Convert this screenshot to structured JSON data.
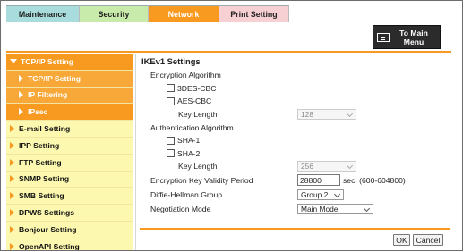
{
  "tabs": {
    "maintenance": "Maintenance",
    "security": "Security",
    "network": "Network",
    "print_setting": "Print Setting"
  },
  "main_menu": {
    "label_line1": "To Main",
    "label_line2": "Menu",
    "icon": "menu-icon"
  },
  "sidebar": {
    "items": [
      {
        "label": "TCP/IP Setting",
        "state": "expanded"
      },
      {
        "label": "TCP/IP Setting",
        "state": "sub"
      },
      {
        "label": "IP Filtering",
        "state": "sub"
      },
      {
        "label": "IPsec",
        "state": "sub-selected"
      },
      {
        "label": "E-mail Setting"
      },
      {
        "label": "IPP Setting"
      },
      {
        "label": "FTP Setting"
      },
      {
        "label": "SNMP Setting"
      },
      {
        "label": "SMB Setting"
      },
      {
        "label": "DPWS Settings"
      },
      {
        "label": "Bonjour Setting"
      },
      {
        "label": "OpenAPI Setting"
      }
    ]
  },
  "content": {
    "title": "IKEv1 Settings",
    "encryption_label": "Encryption Algorithm",
    "enc_3des": "3DES-CBC",
    "enc_aes": "AES-CBC",
    "key_length_label": "Key Length",
    "aes_key_length": "128",
    "auth_label": "Authentication Algorithm",
    "auth_sha1": "SHA-1",
    "auth_sha2": "SHA-2",
    "sha2_key_length_label": "Key Length",
    "sha2_key_length": "256",
    "validity_label": "Encryption Key Validity Period",
    "validity_value": "28800",
    "validity_suffix": "sec. (600-604800)",
    "dh_label": "Diffie-Hellman Group",
    "dh_value": "Group 2",
    "neg_label": "Negotiation Mode",
    "neg_value": "Main Mode"
  },
  "buttons": {
    "ok": "OK",
    "cancel": "Cancel"
  },
  "colors": {
    "accent": "#f79a1f",
    "sidebar_bg": "#fdf8b0",
    "main_menu_bg": "#2b2b2b"
  }
}
